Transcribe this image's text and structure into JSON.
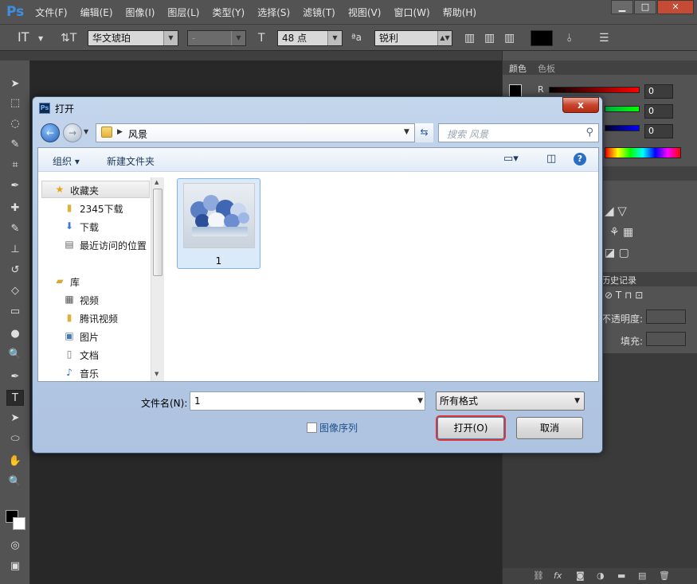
{
  "app": {
    "logo": "Ps",
    "menu": [
      "文件(F)",
      "编辑(E)",
      "图像(I)",
      "图层(L)",
      "类型(Y)",
      "选择(S)",
      "滤镜(T)",
      "视图(V)",
      "窗口(W)",
      "帮助(H)"
    ],
    "window_controls": [
      "minimize-icon",
      "maximize-icon",
      "close-icon"
    ]
  },
  "options_bar": {
    "font_family": "华文琥珀",
    "font_style": "-",
    "font_size": "48 点",
    "aa_symbol": "ªa",
    "antialias": "锐利",
    "text_color": "#000000"
  },
  "right_panel": {
    "color_tabs": [
      "颜色",
      "色板"
    ],
    "channel_label": "R",
    "rgb_values": [
      "0",
      "0",
      "0"
    ],
    "layer_tab": "历史记录",
    "opacity_label": "不透明度:",
    "fill_label": "填充:"
  },
  "dialog": {
    "title": "打开",
    "close_label": "x",
    "breadcrumb": "风景",
    "search_placeholder": "搜索 风景",
    "commands": {
      "organize": "组织 ▾",
      "new_folder": "新建文件夹"
    },
    "nav": [
      {
        "label": "收藏夹",
        "icon": "star-icon"
      },
      {
        "label": "2345下载",
        "icon": "folder-icon"
      },
      {
        "label": "下载",
        "icon": "download-folder-icon"
      },
      {
        "label": "最近访问的位置",
        "icon": "recent-places-icon"
      },
      {
        "label": "库",
        "icon": "library-icon"
      },
      {
        "label": "视频",
        "icon": "video-library-icon"
      },
      {
        "label": "腾讯视频",
        "icon": "folder-icon"
      },
      {
        "label": "图片",
        "icon": "pictures-library-icon"
      },
      {
        "label": "文档",
        "icon": "documents-library-icon"
      },
      {
        "label": "音乐",
        "icon": "music-library-icon"
      }
    ],
    "files": [
      {
        "name": "1"
      }
    ],
    "filename_label": "文件名(N):",
    "filename_value": "1",
    "filetype": "所有格式",
    "sequence_label": "图像序列",
    "open_button": "打开(O)",
    "cancel_button": "取消"
  }
}
